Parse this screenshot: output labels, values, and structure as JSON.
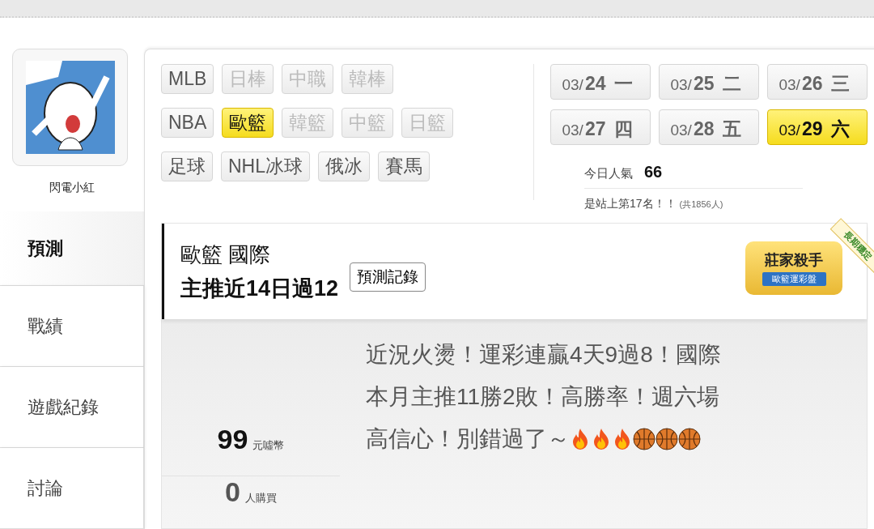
{
  "user": {
    "name": "閃電小紅"
  },
  "nav": [
    {
      "label": "預測",
      "selected": true
    },
    {
      "label": "戰績",
      "selected": false
    },
    {
      "label": "遊戲紀錄",
      "selected": false
    },
    {
      "label": "討論",
      "selected": false
    }
  ],
  "sport_rows": [
    {
      "items": [
        {
          "label": "MLB",
          "selected": false,
          "disabled": false
        },
        {
          "label": "日棒",
          "selected": false,
          "disabled": true
        },
        {
          "label": "中職",
          "selected": false,
          "disabled": true
        },
        {
          "label": "韓棒",
          "selected": false,
          "disabled": true
        }
      ]
    },
    {
      "items": [
        {
          "label": "NBA",
          "selected": false,
          "disabled": false
        },
        {
          "label": "歐籃",
          "selected": true,
          "disabled": false
        },
        {
          "label": "韓籃",
          "selected": false,
          "disabled": true
        },
        {
          "label": "中籃",
          "selected": false,
          "disabled": true
        },
        {
          "label": "日籃",
          "selected": false,
          "disabled": true
        }
      ]
    },
    {
      "items": [
        {
          "label": "足球",
          "selected": false,
          "disabled": false
        },
        {
          "label": "NHL冰球",
          "selected": false,
          "disabled": false
        },
        {
          "label": "俄冰",
          "selected": false,
          "disabled": false
        },
        {
          "label": "賽馬",
          "selected": false,
          "disabled": false
        }
      ]
    }
  ],
  "dates": [
    {
      "month": "03/",
      "day": "24",
      "weekday": "一",
      "selected": false
    },
    {
      "month": "03/",
      "day": "25",
      "weekday": "二",
      "selected": false
    },
    {
      "month": "03/",
      "day": "26",
      "weekday": "三",
      "selected": false
    },
    {
      "month": "03/",
      "day": "27",
      "weekday": "四",
      "selected": false
    },
    {
      "month": "03/",
      "day": "28",
      "weekday": "五",
      "selected": false
    },
    {
      "month": "03/",
      "day": "29",
      "weekday": "六",
      "selected": true
    }
  ],
  "popularity": {
    "label": "今日人氣",
    "value": "66",
    "rank": "是站上第17名！！",
    "total": "(共1856人)"
  },
  "prediction": {
    "league": "歐籃 國際",
    "headline": "主推近14日過12",
    "record_button": "預測記錄",
    "badge": {
      "title": "莊家殺手",
      "subtitle": "歐籃運彩盤",
      "ribbon": "長期穩定"
    },
    "price": "99",
    "price_unit": "元噓幣",
    "buyers": "0",
    "buyers_unit": "人購買",
    "description_lines": [
      "近況火燙！運彩連贏4天9過8！國際",
      "本月主推11勝2敗！高勝率！週六場",
      "高信心！別錯過了～"
    ],
    "icons": [
      {
        "kind": "fire"
      },
      {
        "kind": "fire"
      },
      {
        "kind": "fire"
      },
      {
        "kind": "basketball"
      },
      {
        "kind": "basketball"
      },
      {
        "kind": "basketball"
      }
    ]
  }
}
